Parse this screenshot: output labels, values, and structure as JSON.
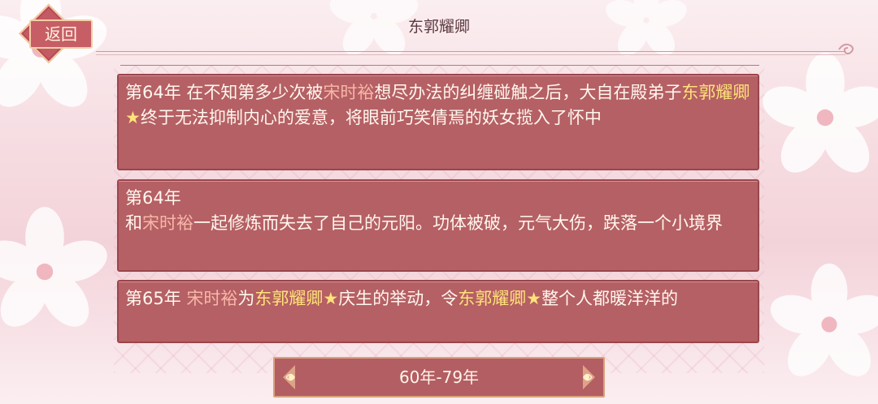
{
  "header": {
    "back_label": "返回",
    "title": "东郭耀卿"
  },
  "entries": [
    {
      "parts": [
        {
          "text": "第64年 在不知第多少次被",
          "style": "normal"
        },
        {
          "text": "宋时裕",
          "style": "pink"
        },
        {
          "text": "想尽办法的纠缠碰触之后，大自在殿弟子",
          "style": "normal"
        },
        {
          "text": "东郭耀卿★",
          "style": "gold"
        },
        {
          "text": "终于无法抑制内心的爱意，将眼前巧笑倩焉的妖女揽入了怀中",
          "style": "normal"
        }
      ]
    },
    {
      "parts": [
        {
          "text": "第64年",
          "style": "normal"
        },
        {
          "text": "\n",
          "style": "break"
        },
        {
          "text": "和",
          "style": "normal"
        },
        {
          "text": "宋时裕",
          "style": "pink"
        },
        {
          "text": "一起修炼而失去了自己的元阳。功体被破，元气大伤，跌落一个小境界",
          "style": "normal"
        }
      ]
    },
    {
      "parts": [
        {
          "text": "第65年 ",
          "style": "normal"
        },
        {
          "text": "宋时裕",
          "style": "pink"
        },
        {
          "text": "为",
          "style": "normal"
        },
        {
          "text": "东郭耀卿★",
          "style": "gold"
        },
        {
          "text": "庆生的举动，令",
          "style": "normal"
        },
        {
          "text": "东郭耀卿★",
          "style": "gold"
        },
        {
          "text": "整个人都暖洋洋的",
          "style": "normal"
        }
      ]
    }
  ],
  "pager": {
    "label": "60年-79年"
  },
  "colors": {
    "panel": "#b56064",
    "highlight_name": "#f7b7a9",
    "highlight_gold": "#ffe27a",
    "text": "#fff7ef"
  },
  "icons": {
    "back": "diamond-plate-icon",
    "page_left": "ornament-corner-icon",
    "page_right": "ornament-corner-icon",
    "title_ornament": "swirl-icon"
  }
}
